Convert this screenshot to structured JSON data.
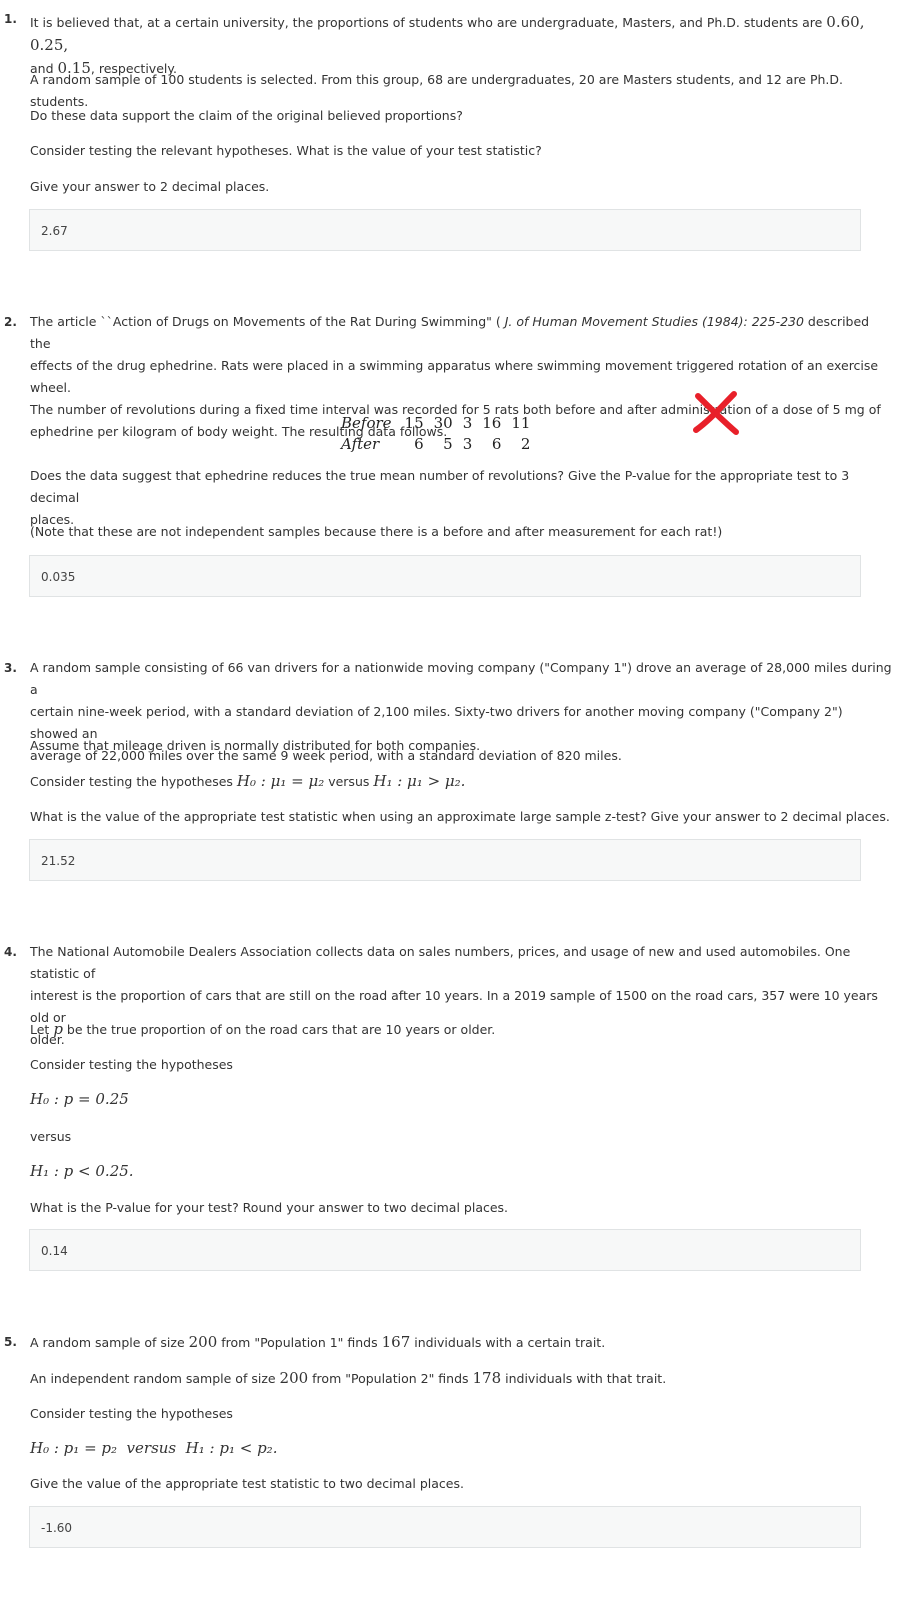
{
  "q1": {
    "number": "1.",
    "p1a": "It is believed that, at a certain university, the proportions of students who are undergraduate, Masters, and Ph.D. students are ",
    "p1m": "0.60, 0.25,",
    "p1b": "and ",
    "p1m2": "0.15",
    "p1c": ", respectively.",
    "p2": "A random sample of 100 students is selected. From this group, 68 are undergraduates, 20 are Masters students, and 12 are Ph.D. students.",
    "p3": "Do these data support the claim of the original believed proportions?",
    "p4": "Consider testing the relevant hypotheses. What is the value of your test statistic?",
    "p5": "Give your answer to 2 decimal places.",
    "answer": "2.67"
  },
  "q2": {
    "number": "2.",
    "l1a": "The article ``Action of Drugs on Movements of the Rat During Swimming\" ( ",
    "l1i": "J. of Human Movement Studies (1984): 225-230",
    "l1b": " described the",
    "l2": "effects of the drug ephedrine. Rats were placed in a swimming apparatus where swimming movement triggered rotation of an exercise wheel.",
    "l3": "The number of revolutions during a fixed time interval was recorded for 5 rats both before and after administration of a dose of 5 mg of",
    "l4": "ephedrine per kilogram of body weight. The resulting data follows.",
    "table": {
      "before_label": "Before",
      "after_label": "After",
      "before": [
        "15",
        "30",
        "3",
        "16",
        "11"
      ],
      "after": [
        "6",
        "5",
        "3",
        "6",
        "2"
      ]
    },
    "p2a": "Does the data suggest that ephedrine reduces the true mean number of revolutions? Give the P-value for the appropriate test to 3 decimal",
    "p2b": "places.",
    "p3": "(Note that these are not independent samples because there is a before and after measurement for each rat!)",
    "answer": "0.035",
    "mark_color": "#e8202a"
  },
  "q3": {
    "number": "3.",
    "l1": "A random sample consisting of 66 van drivers for a nationwide moving company (\"Company 1\") drove an average of 28,000 miles during a",
    "l2": "certain nine-week period, with a standard deviation of 2,100 miles. Sixty-two drivers for another moving company (\"Company 2\") showed an",
    "l3": "average of 22,000 miles over the same 9 week period, with a standard deviation of 820 miles.",
    "p2": "Assume that mileage driven is normally distributed for both companies.",
    "p3a": "Consider testing the hypotheses ",
    "h0": "H₀ : μ₁ = μ₂",
    "versus": " versus ",
    "h1": "H₁ : μ₁ > μ₂.",
    "p4": "What is the value of the appropriate test statistic when using an approximate large sample z-test? Give your answer to 2 decimal places.",
    "answer": "21.52"
  },
  "q4": {
    "number": "4.",
    "l1": "The National Automobile Dealers Association collects data on sales numbers, prices, and usage of new and used automobiles. One statistic of",
    "l2": "interest is the proportion of cars that are still on the road after 10 years. In a 2019 sample of 1500 on the road cars, 357 were 10 years old or",
    "l3": "older.",
    "p2a": "Let ",
    "p2m": "p",
    "p2b": " be the true proportion of on the road cars that are 10 years or older.",
    "p3": "Consider testing the hypotheses",
    "h0": "H₀ : p = 0.25",
    "versus": "versus",
    "h1": "H₁ : p < 0.25.",
    "p4": "What is the P-value for your test? Round your answer to two decimal places.",
    "answer": "0.14"
  },
  "q5": {
    "number": "5.",
    "p1a": "A random sample of size ",
    "p1m1": "200",
    "p1b": " from \"Population 1\" finds ",
    "p1m2": "167",
    "p1c": " individuals with a certain trait.",
    "p2a": "An independent random sample of size ",
    "p2m1": "200",
    "p2b": " from \"Population 2\" finds ",
    "p2m2": "178",
    "p2c": " individuals with that trait.",
    "p3": "Consider testing the hypotheses",
    "hyp": "H₀ : p₁ = p₂  versus  H₁ : p₁ < p₂.",
    "p4": "Give the value of the appropriate test statistic to two decimal places.",
    "answer": "-1.60"
  }
}
